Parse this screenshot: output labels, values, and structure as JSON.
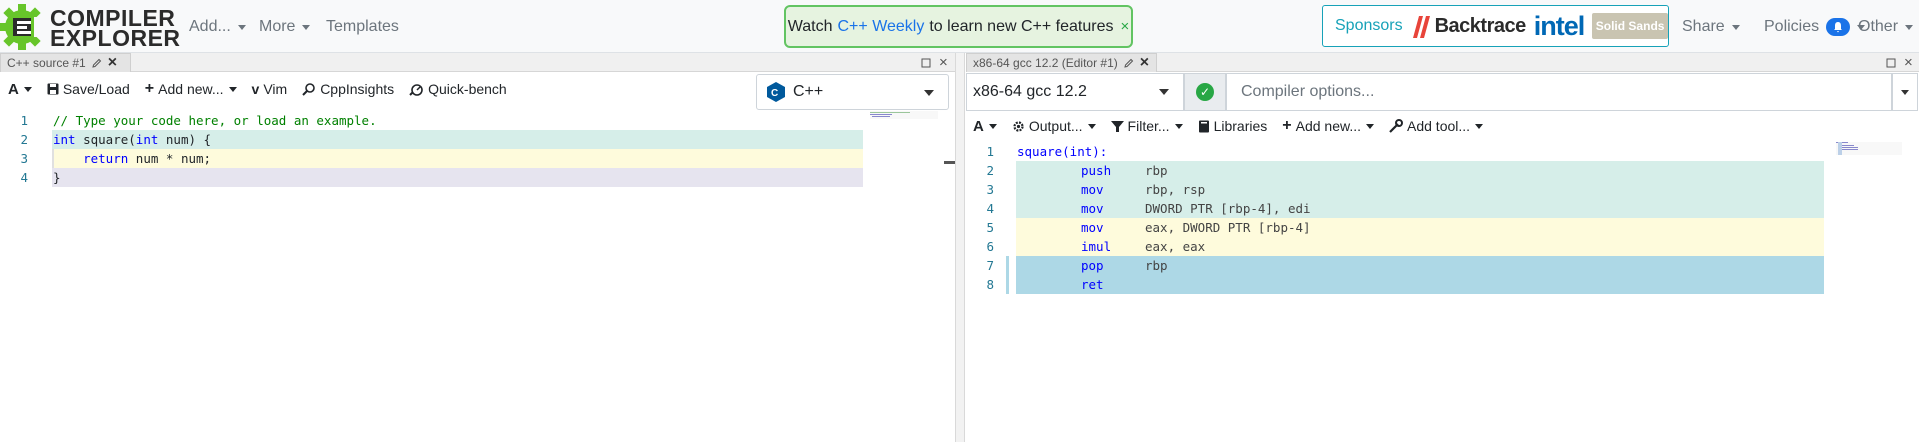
{
  "navbar": {
    "logo_line1": "COMPILER",
    "logo_line2": "EXPLORER",
    "menu": [
      {
        "label": "Add..."
      },
      {
        "label": "More"
      },
      {
        "label": "Templates"
      }
    ],
    "announcement": {
      "prefix": "Watch",
      "link": "C++ Weekly",
      "suffix": "to learn new C++ features",
      "close": "×"
    },
    "sponsors": {
      "label": "Sponsors",
      "backtrace": "Backtrace",
      "intel": "intel",
      "solid": "Solid Sands"
    },
    "right_menu": [
      {
        "label": "Share"
      },
      {
        "label": "Policies"
      },
      {
        "label": "Other"
      }
    ]
  },
  "source_pane": {
    "tab_title": "C++ source #1",
    "toolbar": {
      "font": "A",
      "save_load": "Save/Load",
      "add_new": "Add new...",
      "vim": "Vim",
      "cppinsights": "CppInsights",
      "quickbench": "Quick-bench"
    },
    "language": "C++",
    "lines": [
      {
        "num": "1",
        "text": "// Type your code here, or load an example."
      },
      {
        "num": "2",
        "text": "int square(int num) {"
      },
      {
        "num": "3",
        "text": "    return num * num;"
      },
      {
        "num": "4",
        "text": "}"
      }
    ]
  },
  "compiler_pane": {
    "tab_title": "x86-64 gcc 12.2 (Editor #1)",
    "compiler": "x86-64 gcc 12.2",
    "options_placeholder": "Compiler options...",
    "toolbar": {
      "font": "A",
      "output": "Output...",
      "filter": "Filter...",
      "libraries": "Libraries",
      "add_new": "Add new...",
      "add_tool": "Add tool..."
    },
    "asm_lines": [
      {
        "num": "1",
        "label": "square(int):",
        "op": "",
        "args": ""
      },
      {
        "num": "2",
        "label": "",
        "op": "push",
        "args": "rbp"
      },
      {
        "num": "3",
        "label": "",
        "op": "mov",
        "args": "rbp, rsp"
      },
      {
        "num": "4",
        "label": "",
        "op": "mov",
        "args": "DWORD PTR [rbp-4], edi"
      },
      {
        "num": "5",
        "label": "",
        "op": "mov",
        "args": "eax, DWORD PTR [rbp-4]"
      },
      {
        "num": "6",
        "label": "",
        "op": "imul",
        "args": "eax, eax"
      },
      {
        "num": "7",
        "label": "",
        "op": "pop",
        "args": "rbp"
      },
      {
        "num": "8",
        "label": "",
        "op": "ret",
        "args": ""
      }
    ]
  },
  "colors": {
    "accent": "#17a2b8",
    "highlight_green": "#d6eee9",
    "highlight_yellow": "#fefbdc",
    "highlight_lavender": "#e6e4ef",
    "highlight_blue": "#add8e6"
  }
}
